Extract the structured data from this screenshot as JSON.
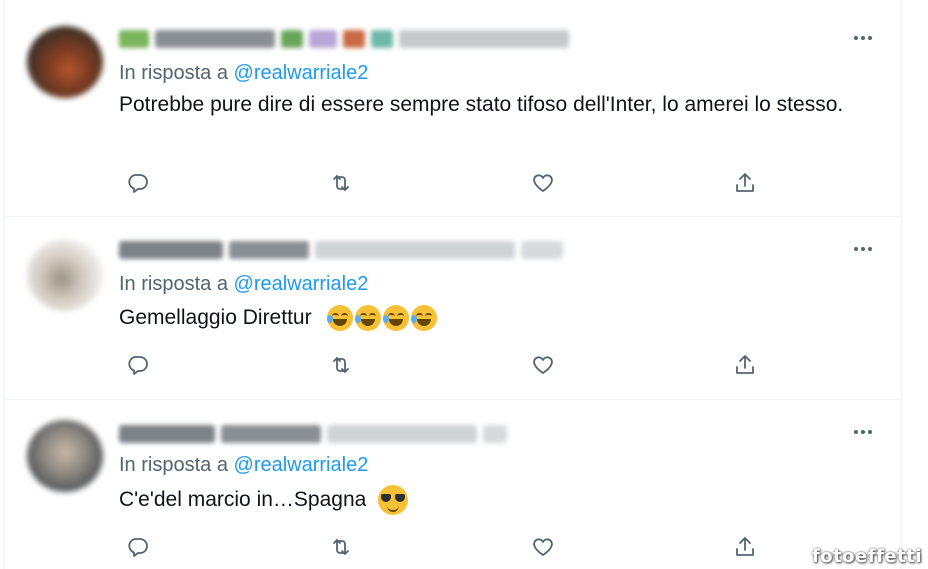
{
  "tweets": [
    {
      "reply_prefix": "In risposta a",
      "reply_handle": "@realwarriale2",
      "text": "Potrebbe pure dire di essere sempre stato tifoso dell'Inter, lo amerei lo stesso.",
      "emoji": []
    },
    {
      "reply_prefix": "In risposta a",
      "reply_handle": "@realwarriale2",
      "text": "Gemellaggio Direttur",
      "emoji": [
        "rolling-on-floor-laughing",
        "rolling-on-floor-laughing",
        "rolling-on-floor-laughing",
        "rolling-on-floor-laughing"
      ]
    },
    {
      "reply_prefix": "In risposta a",
      "reply_handle": "@realwarriale2",
      "text": "C'e'del marcio in…Spagna",
      "emoji": [
        "smiling-face-with-sunglasses"
      ]
    }
  ],
  "icons": {
    "more": "more-icon",
    "reply": "reply-icon",
    "retweet": "retweet-icon",
    "like": "heart-icon",
    "share": "share-icon"
  },
  "colors": {
    "link": "#1d9bf0",
    "secondary_text": "#536471",
    "divider": "#eff3f4"
  },
  "watermark": "fotoeffetti"
}
